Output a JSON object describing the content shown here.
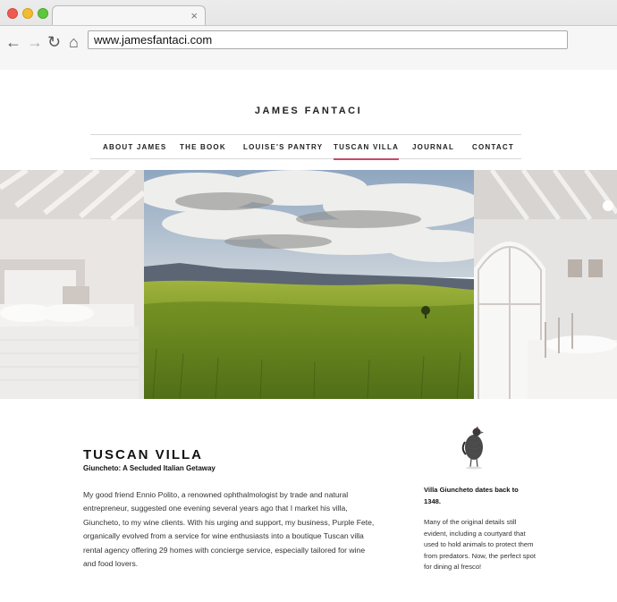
{
  "browser": {
    "url": "www.jamesfantaci.com",
    "tab_close": "×",
    "back_icon": "←",
    "forward_icon": "→",
    "reload_icon": "↻",
    "home_icon": "⌂"
  },
  "site": {
    "title": "JAMES FANTACI"
  },
  "nav": {
    "items": [
      "ABOUT JAMES",
      "THE BOOK",
      "LOUISE'S PANTRY",
      "TUSCAN VILLA",
      "JOURNAL",
      "CONTACT"
    ],
    "active": "TUSCAN VILLA",
    "accent_color": "#c64a6a"
  },
  "main": {
    "heading": "TUSCAN VILLA",
    "subheading": "Giuncheto: A Secluded Italian Getaway",
    "body": "My good friend Ennio Polito, a renowned ophthalmologist by trade and natural entrepreneur, suggested one evening several years ago that I market his villa, Giuncheto, to my wine clients. With his urging and support, my business, Purple Fete, organically evolved from a service for wine enthusiasts into a boutique Tuscan villa rental agency offering 29 homes with concierge service, especially tailored for wine and food lovers."
  },
  "sidebar": {
    "title": "Villa Giuncheto dates back to 1348.",
    "text": "Many of the original details still evident, including a courtyard that used to hold animals to protect them from predators. Now, the perfect spot for dining al fresco!"
  }
}
